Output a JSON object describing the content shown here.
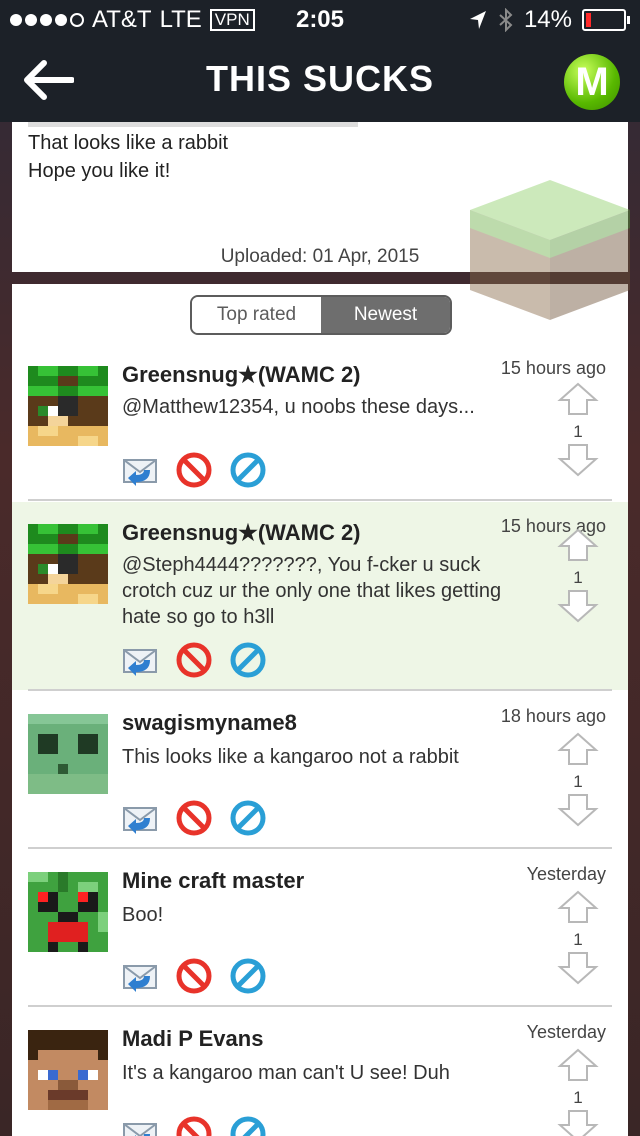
{
  "status_bar": {
    "carrier": "AT&T",
    "network": "LTE",
    "vpn": "VPN",
    "time": "2:05",
    "battery": "14%",
    "battery_level": 0.14
  },
  "nav": {
    "title": "THIS SUCKS",
    "logo_letter": "M"
  },
  "post": {
    "lines": [
      "That looks like a rabbit",
      "Hope you like it!"
    ],
    "uploaded": "Uploaded: 01 Apr, 2015"
  },
  "sort_tabs": {
    "top_rated": "Top rated",
    "newest": "Newest",
    "selected": "Newest"
  },
  "comments": [
    {
      "author": "Greensnug★(WAMC 2)",
      "time": "15 hours ago",
      "text": "@Matthew12354, u noobs these days...",
      "votes": "1",
      "highlighted": false
    },
    {
      "author": "Greensnug★(WAMC 2)",
      "time": "15 hours ago",
      "text": "@Steph4444???????, You f-cker u suck crotch cuz ur the only one that likes getting hate so go to h3ll",
      "votes": "1",
      "highlighted": true
    },
    {
      "author": "swagismyname8",
      "time": "18 hours ago",
      "text": "This looks like a kangaroo not a rabbit",
      "votes": "1",
      "highlighted": false
    },
    {
      "author": "Mine craft master",
      "time": "Yesterday",
      "text": "Boo!",
      "votes": "1",
      "highlighted": false
    },
    {
      "author": "Madi P Evans",
      "time": "Yesterday",
      "text": "It's a kangaroo man can't U see! Duh",
      "votes": "1",
      "highlighted": false
    }
  ],
  "icons": {
    "reply": "reply-icon",
    "report": "report-icon",
    "block": "block-icon",
    "upvote": "upvote-arrow-icon",
    "downvote": "downvote-arrow-icon"
  },
  "colors": {
    "nav_bg": "#1c2128",
    "highlight_bg": "#eef6e6",
    "logo_green": "#58b800",
    "report_red": "#e8332a",
    "block_blue": "#2a9fd6"
  }
}
